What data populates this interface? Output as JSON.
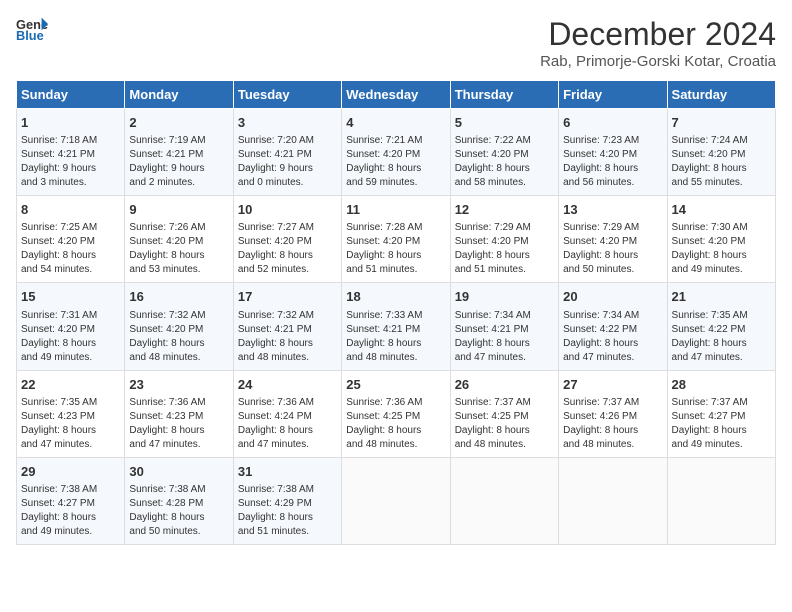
{
  "header": {
    "logo_line1": "General",
    "logo_line2": "Blue",
    "title": "December 2024",
    "subtitle": "Rab, Primorje-Gorski Kotar, Croatia"
  },
  "calendar": {
    "days_of_week": [
      "Sunday",
      "Monday",
      "Tuesday",
      "Wednesday",
      "Thursday",
      "Friday",
      "Saturday"
    ],
    "weeks": [
      [
        {
          "day": "1",
          "info": "Sunrise: 7:18 AM\nSunset: 4:21 PM\nDaylight: 9 hours\nand 3 minutes."
        },
        {
          "day": "2",
          "info": "Sunrise: 7:19 AM\nSunset: 4:21 PM\nDaylight: 9 hours\nand 2 minutes."
        },
        {
          "day": "3",
          "info": "Sunrise: 7:20 AM\nSunset: 4:21 PM\nDaylight: 9 hours\nand 0 minutes."
        },
        {
          "day": "4",
          "info": "Sunrise: 7:21 AM\nSunset: 4:20 PM\nDaylight: 8 hours\nand 59 minutes."
        },
        {
          "day": "5",
          "info": "Sunrise: 7:22 AM\nSunset: 4:20 PM\nDaylight: 8 hours\nand 58 minutes."
        },
        {
          "day": "6",
          "info": "Sunrise: 7:23 AM\nSunset: 4:20 PM\nDaylight: 8 hours\nand 56 minutes."
        },
        {
          "day": "7",
          "info": "Sunrise: 7:24 AM\nSunset: 4:20 PM\nDaylight: 8 hours\nand 55 minutes."
        }
      ],
      [
        {
          "day": "8",
          "info": "Sunrise: 7:25 AM\nSunset: 4:20 PM\nDaylight: 8 hours\nand 54 minutes."
        },
        {
          "day": "9",
          "info": "Sunrise: 7:26 AM\nSunset: 4:20 PM\nDaylight: 8 hours\nand 53 minutes."
        },
        {
          "day": "10",
          "info": "Sunrise: 7:27 AM\nSunset: 4:20 PM\nDaylight: 8 hours\nand 52 minutes."
        },
        {
          "day": "11",
          "info": "Sunrise: 7:28 AM\nSunset: 4:20 PM\nDaylight: 8 hours\nand 51 minutes."
        },
        {
          "day": "12",
          "info": "Sunrise: 7:29 AM\nSunset: 4:20 PM\nDaylight: 8 hours\nand 51 minutes."
        },
        {
          "day": "13",
          "info": "Sunrise: 7:29 AM\nSunset: 4:20 PM\nDaylight: 8 hours\nand 50 minutes."
        },
        {
          "day": "14",
          "info": "Sunrise: 7:30 AM\nSunset: 4:20 PM\nDaylight: 8 hours\nand 49 minutes."
        }
      ],
      [
        {
          "day": "15",
          "info": "Sunrise: 7:31 AM\nSunset: 4:20 PM\nDaylight: 8 hours\nand 49 minutes."
        },
        {
          "day": "16",
          "info": "Sunrise: 7:32 AM\nSunset: 4:20 PM\nDaylight: 8 hours\nand 48 minutes."
        },
        {
          "day": "17",
          "info": "Sunrise: 7:32 AM\nSunset: 4:21 PM\nDaylight: 8 hours\nand 48 minutes."
        },
        {
          "day": "18",
          "info": "Sunrise: 7:33 AM\nSunset: 4:21 PM\nDaylight: 8 hours\nand 48 minutes."
        },
        {
          "day": "19",
          "info": "Sunrise: 7:34 AM\nSunset: 4:21 PM\nDaylight: 8 hours\nand 47 minutes."
        },
        {
          "day": "20",
          "info": "Sunrise: 7:34 AM\nSunset: 4:22 PM\nDaylight: 8 hours\nand 47 minutes."
        },
        {
          "day": "21",
          "info": "Sunrise: 7:35 AM\nSunset: 4:22 PM\nDaylight: 8 hours\nand 47 minutes."
        }
      ],
      [
        {
          "day": "22",
          "info": "Sunrise: 7:35 AM\nSunset: 4:23 PM\nDaylight: 8 hours\nand 47 minutes."
        },
        {
          "day": "23",
          "info": "Sunrise: 7:36 AM\nSunset: 4:23 PM\nDaylight: 8 hours\nand 47 minutes."
        },
        {
          "day": "24",
          "info": "Sunrise: 7:36 AM\nSunset: 4:24 PM\nDaylight: 8 hours\nand 47 minutes."
        },
        {
          "day": "25",
          "info": "Sunrise: 7:36 AM\nSunset: 4:25 PM\nDaylight: 8 hours\nand 48 minutes."
        },
        {
          "day": "26",
          "info": "Sunrise: 7:37 AM\nSunset: 4:25 PM\nDaylight: 8 hours\nand 48 minutes."
        },
        {
          "day": "27",
          "info": "Sunrise: 7:37 AM\nSunset: 4:26 PM\nDaylight: 8 hours\nand 48 minutes."
        },
        {
          "day": "28",
          "info": "Sunrise: 7:37 AM\nSunset: 4:27 PM\nDaylight: 8 hours\nand 49 minutes."
        }
      ],
      [
        {
          "day": "29",
          "info": "Sunrise: 7:38 AM\nSunset: 4:27 PM\nDaylight: 8 hours\nand 49 minutes."
        },
        {
          "day": "30",
          "info": "Sunrise: 7:38 AM\nSunset: 4:28 PM\nDaylight: 8 hours\nand 50 minutes."
        },
        {
          "day": "31",
          "info": "Sunrise: 7:38 AM\nSunset: 4:29 PM\nDaylight: 8 hours\nand 51 minutes."
        },
        {
          "day": "",
          "info": ""
        },
        {
          "day": "",
          "info": ""
        },
        {
          "day": "",
          "info": ""
        },
        {
          "day": "",
          "info": ""
        }
      ]
    ]
  }
}
